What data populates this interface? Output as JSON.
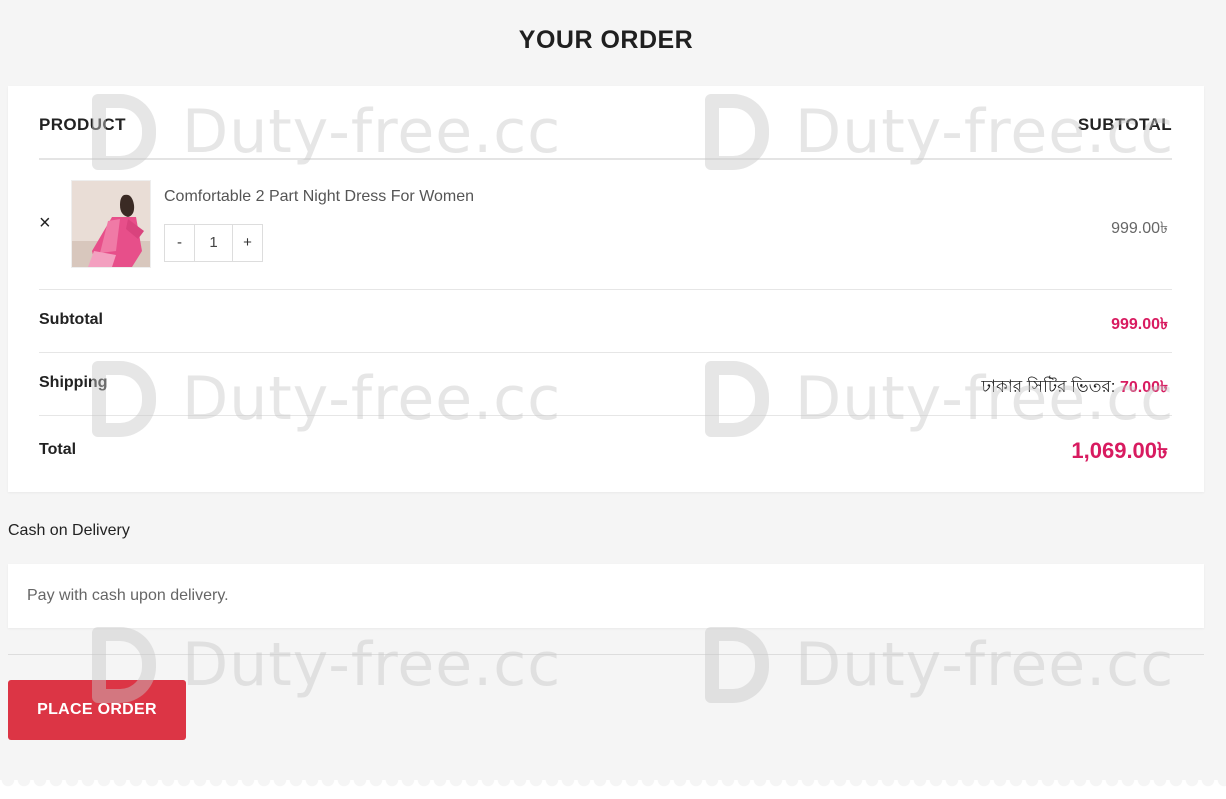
{
  "page_title": "YOUR ORDER",
  "table_header": {
    "product": "PRODUCT",
    "subtotal": "SUBTOTAL"
  },
  "cart_item": {
    "remove_symbol": "×",
    "name": "Comfortable 2 Part Night Dress For Women",
    "quantity": "1",
    "minus": "-",
    "plus": "+",
    "price": "999.00৳"
  },
  "summary": {
    "subtotal_label": "Subtotal",
    "subtotal_value": "999.00৳",
    "shipping_label": "Shipping",
    "shipping_method": "ঢাকার সিটির ভিতর:",
    "shipping_value": "70.00৳",
    "total_label": "Total",
    "total_value": "1,069.00৳"
  },
  "payment": {
    "method": "Cash on Delivery",
    "description": "Pay with cash upon delivery."
  },
  "place_order_label": "PLACE ORDER",
  "watermark_text": "Duty-free.cc",
  "colors": {
    "accent": "#d81b60",
    "button": "#dc3545",
    "background": "#f5f5f5"
  }
}
